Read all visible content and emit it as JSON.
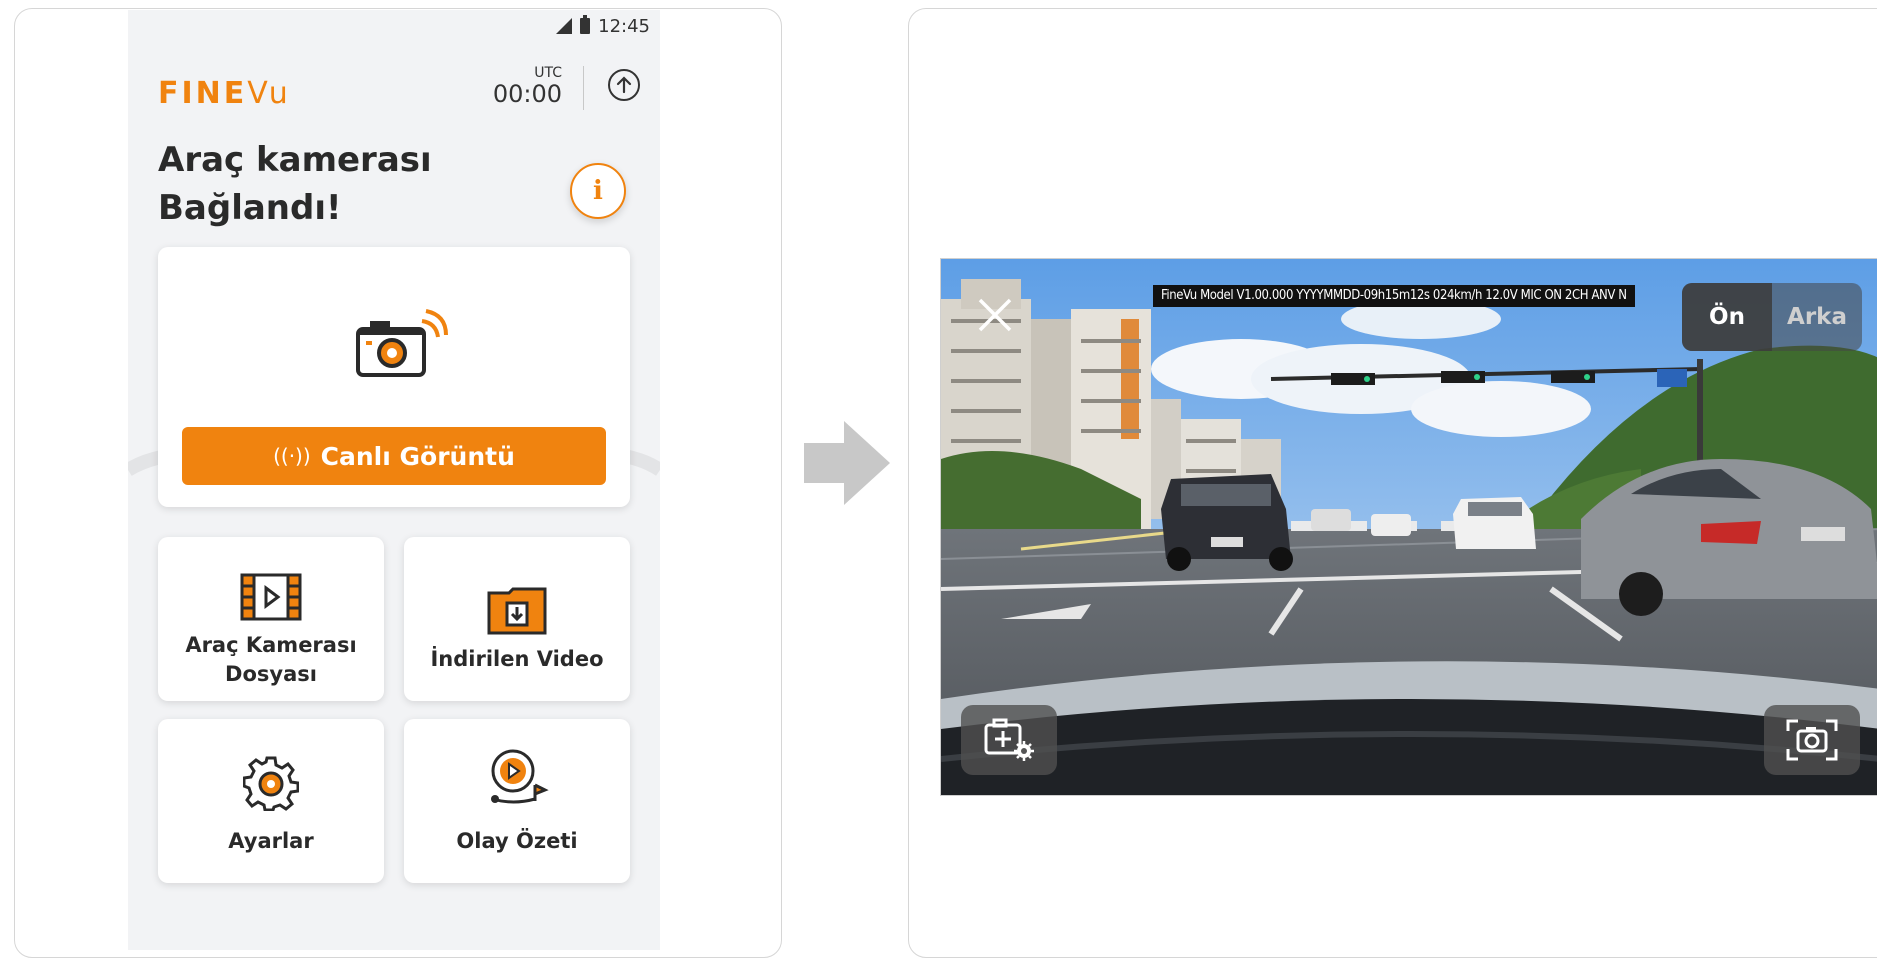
{
  "phone": {
    "status": {
      "time": "12:45"
    },
    "brand": {
      "fine": "FINE",
      "vu": "Vu"
    },
    "utc": {
      "label": "UTC",
      "time": "00:00"
    },
    "headline": [
      "Araç kamerası",
      "Bağlandı!"
    ],
    "info_label": "i",
    "live": {
      "button_icon": "((·))",
      "button_label": "Canlı Görüntü"
    },
    "tiles": [
      {
        "label_lines": [
          "Araç Kamerası",
          "Dosyası"
        ],
        "icon": "film-icon"
      },
      {
        "label_lines": [
          "İndirilen Video"
        ],
        "icon": "download-folder-icon"
      },
      {
        "label_lines": [
          "Ayarlar"
        ],
        "icon": "gear-icon"
      },
      {
        "label_lines": [
          "Olay Özeti"
        ],
        "icon": "event-play-icon"
      }
    ]
  },
  "live_view": {
    "overlay_text": "FineVu Model V1.00.000 YYYYMMDD-09h15m12s 024km/h 12.0V MIC ON 2CH ANV N",
    "camera_switch": {
      "front": "Ön",
      "rear": "Arka",
      "selected": "front"
    },
    "close_icon": "close-icon",
    "settings_icon": "camera-settings-icon",
    "snapshot_icon": "screenshot-camera-icon"
  },
  "colors": {
    "accent": "#f0830f",
    "background": "#f2f3f5",
    "text": "#2a2a2a"
  }
}
